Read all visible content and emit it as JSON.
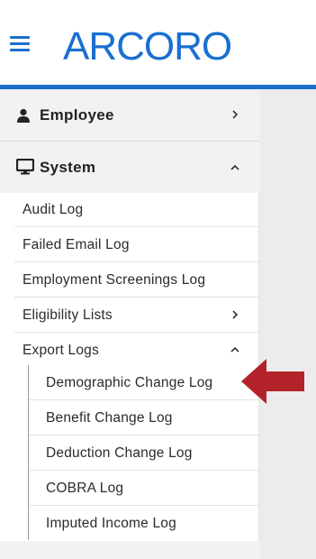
{
  "header": {
    "menu_icon": "hamburger-icon",
    "logo_text": "ARCORO",
    "brand_color": "#1a6fd1"
  },
  "sidebar": {
    "sections": [
      {
        "label": "Employee",
        "icon": "user-icon",
        "state": "collapsed",
        "chevron": "chevron-right-icon"
      },
      {
        "label": "System",
        "icon": "monitor-icon",
        "state": "expanded",
        "chevron": "chevron-up-icon"
      }
    ],
    "system_items": [
      {
        "label": "Audit Log"
      },
      {
        "label": "Failed Email Log"
      },
      {
        "label": "Employment Screenings Log"
      },
      {
        "label": "Eligibility Lists",
        "chevron": "chevron-right-icon"
      },
      {
        "label": "Export Logs",
        "chevron": "chevron-up-icon"
      }
    ],
    "export_logs_items": [
      {
        "label": "Demographic Change Log"
      },
      {
        "label": "Benefit Change Log"
      },
      {
        "label": "Deduction Change Log"
      },
      {
        "label": "COBRA Log"
      },
      {
        "label": "Imputed Income Log"
      }
    ]
  },
  "annotation": {
    "arrow_icon": "left-arrow-icon",
    "arrow_color": "#b5232a"
  }
}
